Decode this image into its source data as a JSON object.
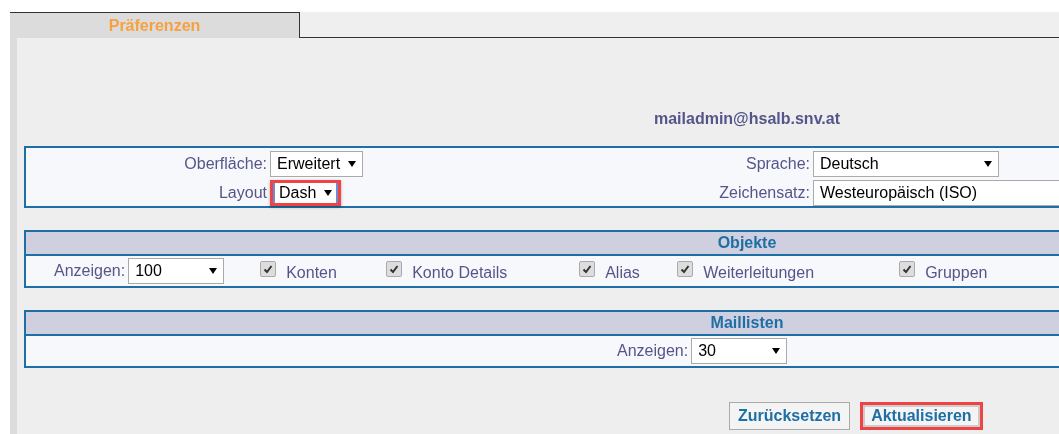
{
  "tabs": [
    {
      "label": "Präferenzen",
      "selected": true
    }
  ],
  "account": "mailadmin@hsalb.snv.at",
  "settings": [
    {
      "label": "Oberfläche:",
      "value": "Erweitert",
      "highlighted": false
    },
    {
      "label": "Layout",
      "value": "Dash",
      "highlighted": true
    },
    {
      "label": "Sprache:",
      "value": "Deutsch",
      "highlighted": false
    },
    {
      "label": "Zeichensatz:",
      "value": "Westeuropäisch (ISO)",
      "highlighted": false
    }
  ],
  "objects": {
    "title": "Objekte",
    "show_label": "Anzeigen:",
    "show_value": "100",
    "items": [
      {
        "label": "Konten",
        "checked": true
      },
      {
        "label": "Konto Details",
        "checked": true
      },
      {
        "label": "Alias",
        "checked": true
      },
      {
        "label": "Weiterleitungen",
        "checked": true
      },
      {
        "label": "Gruppen",
        "checked": true
      }
    ]
  },
  "maillists": {
    "title": "Maillisten",
    "show_label": "Anzeigen:",
    "show_value": "30"
  },
  "buttons": [
    {
      "label": "Zurücksetzen",
      "highlighted": false
    },
    {
      "label": "Aktualisieren",
      "highlighted": true
    }
  ]
}
